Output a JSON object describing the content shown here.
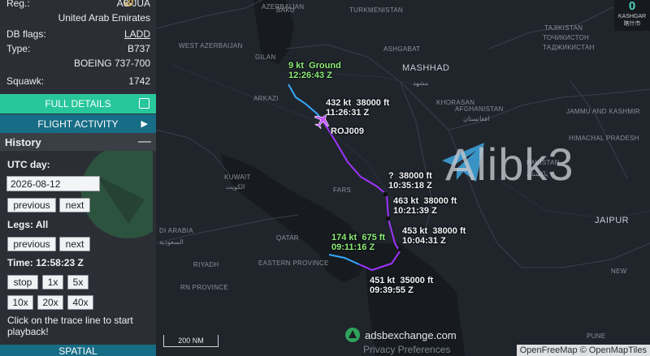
{
  "panel": {
    "reg_label": "Reg.:",
    "reg_value": "A6-JUA",
    "operator": "United Arab Emirates",
    "db_flags_label": "DB flags:",
    "db_flags_value": "LADD",
    "type_label": "Type:",
    "type_value": "B737",
    "model": "BOEING 737-700",
    "squawk_label": "Squawk:",
    "squawk_value": "1742",
    "full_details": "FULL DETAILS",
    "flight_activity": "FLIGHT ACTIVITY",
    "history_title": "History",
    "utc_day_label": "UTC day:",
    "utc_day_value": "2026-08-12",
    "previous": "previous",
    "next": "next",
    "legs_label": "Legs: All",
    "time_label": "Time: 12:58:23 Z",
    "stop": "stop",
    "speeds": [
      "1x",
      "5x",
      "10x",
      "20x",
      "40x"
    ],
    "hint": "Click on the trace line to start playback!",
    "spatial": "SPATIAL"
  },
  "map": {
    "places": [
      "AZERBAIJAN",
      "BAKU",
      "TURKMENISTAN",
      "WEST AZERBAIJAN",
      "GILAN",
      "ASHGABAT",
      "MASHHAD",
      "مشهد",
      "ARKAZI",
      "AFGHANISTAN",
      "افغانستان",
      "TAJIKISTAN",
      "ТОЧИКИСТОН",
      "JAMMU AND KASHMIR",
      "HIMACHAL PRADESH",
      "PAKISTAN",
      "پاکستان",
      "KUWAIT",
      "الكويت",
      "QATAR",
      "DI ARABIA",
      "السعودية",
      "RIYADH",
      "RN PROVINCE",
      "EASTERN PROVINCE",
      "JAIPUR",
      "NEW",
      "KASHGAR",
      "喀什市",
      "PUNE",
      "ТАДЖИКИСТАН",
      "FARS",
      "KHORASAN"
    ],
    "callsign": "ROJ009",
    "labels": [
      {
        "speed": "9 kt",
        "alt": "Ground",
        "time": "12:26:43 Z",
        "color": "green"
      },
      {
        "speed": "432 kt",
        "alt": "38000 ft",
        "time": "11:26:31 Z",
        "color": "white"
      },
      {
        "speed": "?",
        "alt": "38000 ft",
        "time": "10:35:18 Z",
        "color": "white"
      },
      {
        "speed": "463 kt",
        "alt": "38000 ft",
        "time": "10:21:39 Z",
        "color": "white"
      },
      {
        "speed": "453 kt",
        "alt": "38000 ft",
        "time": "10:04:31 Z",
        "color": "white"
      },
      {
        "speed": "174 kt",
        "alt": "675 ft",
        "time": "09:11:16 Z",
        "color": "green"
      },
      {
        "speed": "451 kt",
        "alt": "35000 ft",
        "time": "09:39:55 Z",
        "color": "white"
      }
    ],
    "watermark": "Alibk3",
    "scale": "200 NM",
    "brand": "adsbexchange.com",
    "privacy": "Privacy Preferences",
    "attribution": "OpenFreeMap © OpenMapTiles",
    "counter_num": "0",
    "counter_sub1": "KASHGAR",
    "counter_sub2": "喀什市"
  },
  "colors": {
    "full_details": "#28c79b",
    "flight_activity": "#176d86",
    "track_purple": "#a033ff",
    "track_blue": "#35a8ff"
  },
  "icons": [
    "sun-icon",
    "external-link-icon",
    "chevron-right-icon",
    "minus-icon",
    "telegram-icon",
    "adsb-logo-icon",
    "aircraft-icon"
  ]
}
